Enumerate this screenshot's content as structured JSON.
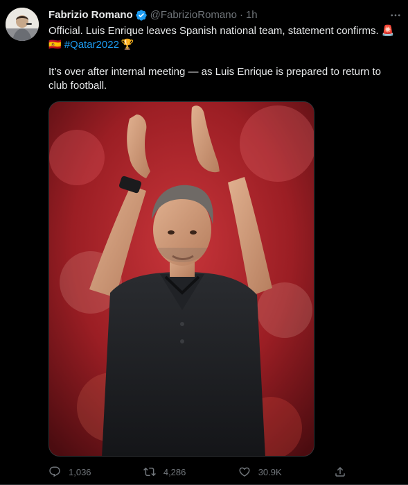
{
  "tweet": {
    "author_name": "Fabrizio Romano",
    "handle": "@FabrizioRomano",
    "separator": "·",
    "time": "1h",
    "text_line1": "Official. Luis Enrique leaves Spanish national team, statement confirms. 🚨",
    "flag": "🇪🇸",
    "hashtag": "#Qatar2022",
    "trophy": "🏆",
    "text_para": "It’s over after internal meeting — as Luis Enrique is prepared to return to club football."
  },
  "actions": {
    "replies": "1,036",
    "retweets": "4,286",
    "likes": "30.9K"
  },
  "icons": {
    "verified": "verified-badge-icon",
    "more": "more-options-icon",
    "reply": "reply-icon",
    "retweet": "retweet-icon",
    "like": "heart-icon",
    "share": "share-icon"
  },
  "colors": {
    "background": "#000000",
    "text": "#e7e9ea",
    "muted": "#71767b",
    "accent": "#1d9bf0"
  }
}
